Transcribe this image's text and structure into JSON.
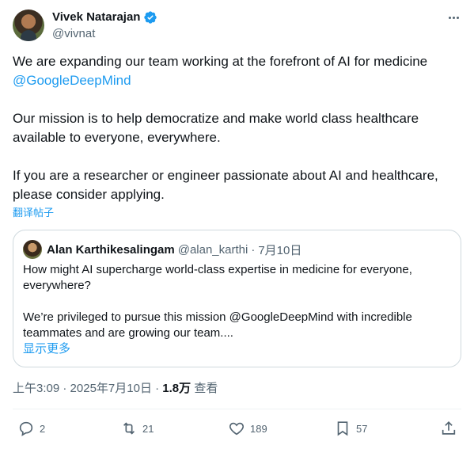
{
  "author": {
    "name": "Vivek Natarajan",
    "handle": "@vivnat"
  },
  "tweet": {
    "line1": "We are expanding our team working at the forefront of AI for medicine",
    "mention": "@GoogleDeepMind",
    "para2": "Our mission is to help democratize and make world class healthcare available to everyone, everywhere.",
    "para3": "If you are a researcher or engineer passionate about AI and healthcare, please consider applying.",
    "translate": "翻译帖子"
  },
  "quote": {
    "name": "Alan Karthikesalingam",
    "handle": "@alan_karthi",
    "dot": "·",
    "date": "7月10日",
    "para1": "How might AI supercharge world-class expertise in medicine for everyone, everywhere?",
    "para2": "We’re privileged to pursue this mission @GoogleDeepMind with incredible teammates and are growing our team....",
    "show_more": "显示更多"
  },
  "meta": {
    "time": "上午3:09",
    "dot1": " · ",
    "date": "2025年7月10日",
    "dot2": " · ",
    "views": "1.8万",
    "views_label": " 查看"
  },
  "actions": {
    "replies": "2",
    "retweets": "21",
    "likes": "189",
    "bookmarks": "57"
  },
  "colors": {
    "link": "#1d9bf0",
    "text": "#0f1419",
    "muted": "#536471",
    "border": "#cfd9de"
  },
  "icons": [
    "verified-badge-icon",
    "more-icon",
    "reply-icon",
    "retweet-icon",
    "like-icon",
    "bookmark-icon",
    "share-icon"
  ]
}
